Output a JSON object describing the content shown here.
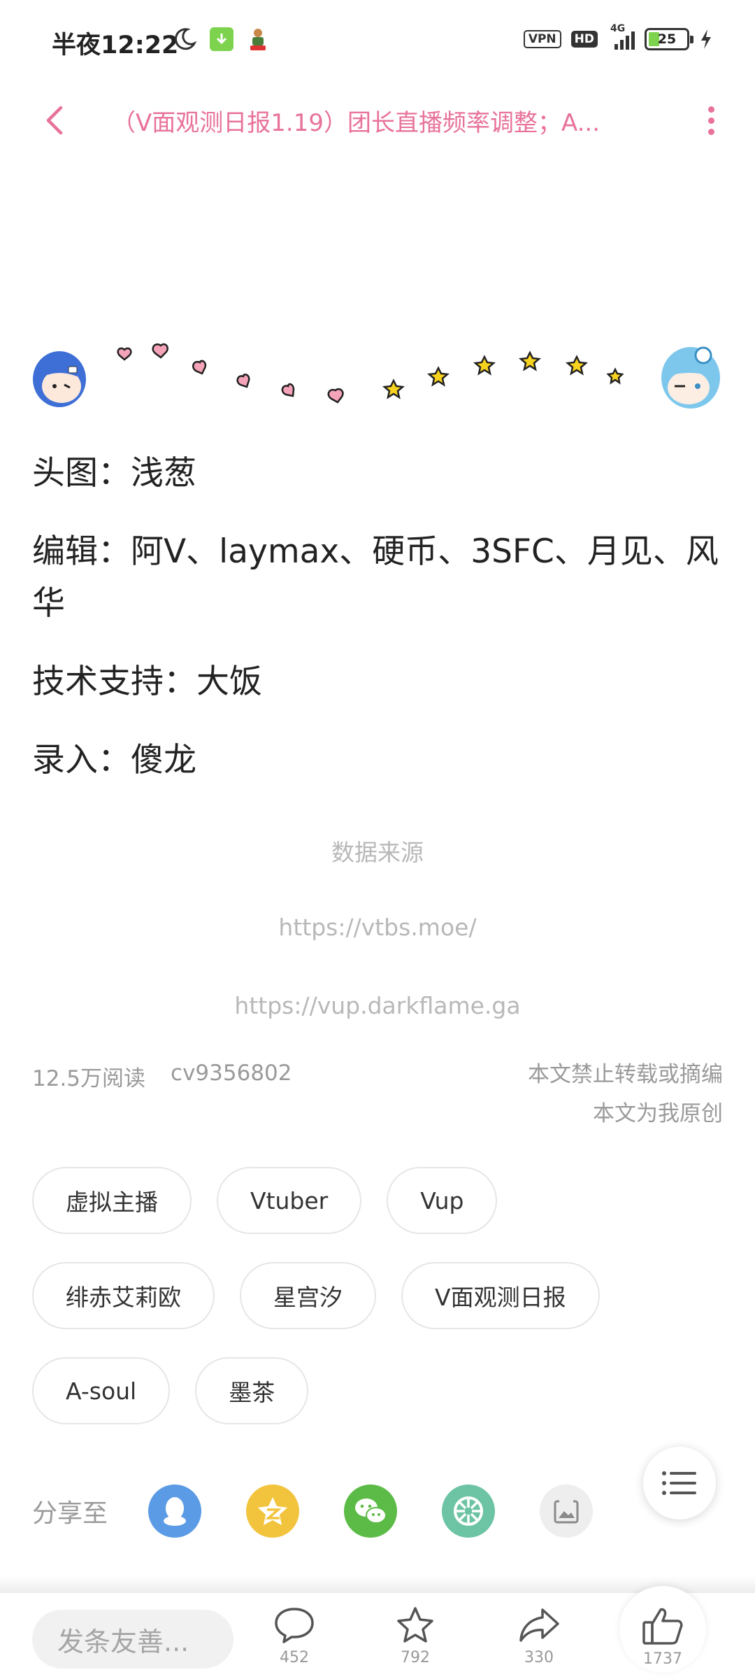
{
  "status_bar": {
    "time": "半夜12:22",
    "vpn": "VPN",
    "hd": "HD",
    "network": "4G",
    "battery": "25"
  },
  "header": {
    "title": "（V面观测日报1.19）团长直播频率调整；A..."
  },
  "credits": {
    "head_image": "头图：浅葱",
    "editors": "编辑：阿V、laymax、硬币、3SFC、月见、风华",
    "tech": "技术支持：大饭",
    "input": "录入：傻龙"
  },
  "source": {
    "label": "数据来源",
    "link1": "https://vtbs.moe/",
    "link2": "https://vup.darkflame.ga"
  },
  "meta": {
    "views": "12.5万阅读",
    "cv": "cv9356802",
    "notice1": "本文禁止转载或摘编",
    "notice2": "本文为我原创"
  },
  "tags": [
    [
      "虚拟主播",
      "Vtuber",
      "Vup"
    ],
    [
      "绯赤艾莉欧",
      "星宫汐",
      "V面观测日报"
    ],
    [
      "A-soul",
      "墨茶"
    ]
  ],
  "share": {
    "label": "分享至",
    "targets": [
      "qq-icon",
      "qzone-icon",
      "wechat-icon",
      "moments-icon",
      "poster-icon"
    ]
  },
  "bottom": {
    "comment_placeholder": "发条友善...",
    "comments": "452",
    "favorites": "792",
    "shares": "330",
    "likes": "1737"
  },
  "colors": {
    "accent": "#e8729b",
    "qq": "#5b9be5",
    "qzone": "#f2c43e",
    "wechat": "#5cbb46",
    "moments": "#6dc4a4"
  }
}
